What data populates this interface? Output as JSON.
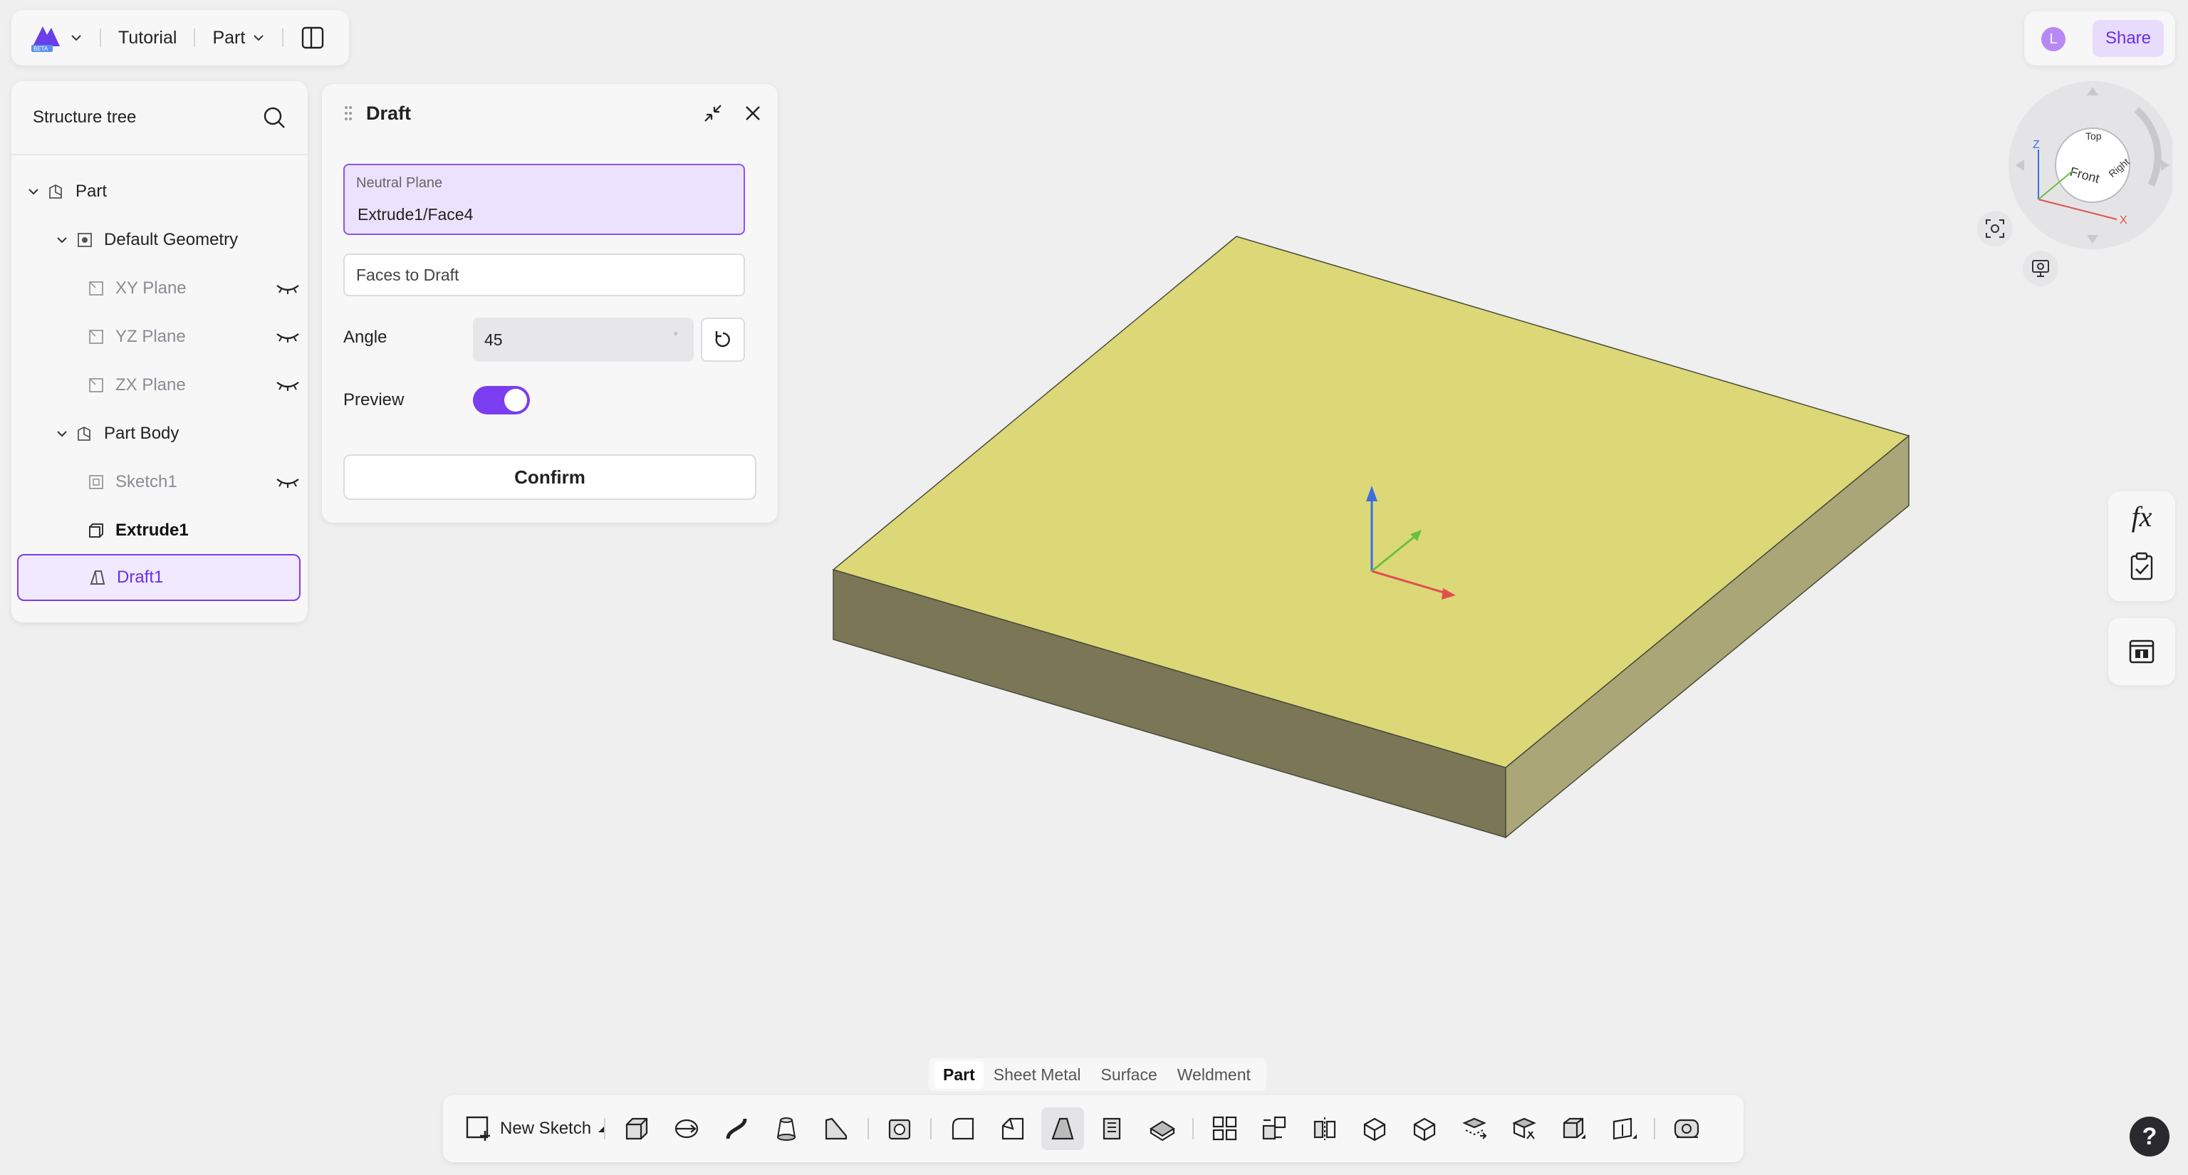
{
  "topbar": {
    "logo_icon": "onshape-beta-logo-icon",
    "doc_title": "Tutorial",
    "workspace": "Part",
    "layout_icon": "panel-layout-icon"
  },
  "tree": {
    "title": "Structure tree",
    "items": [
      {
        "label": "Part"
      },
      {
        "label": "Default Geometry"
      },
      {
        "label": "XY Plane"
      },
      {
        "label": "YZ Plane"
      },
      {
        "label": "ZX Plane"
      },
      {
        "label": "Part Body"
      },
      {
        "label": "Sketch1"
      },
      {
        "label": "Extrude1"
      },
      {
        "label": "Draft1"
      }
    ]
  },
  "draft": {
    "title": "Draft",
    "neutral_plane_label": "Neutral Plane",
    "neutral_plane_value": "Extrude1/Face4",
    "faces_placeholder": "Faces to Draft",
    "angle_label": "Angle",
    "angle_value": "45",
    "angle_unit": "°",
    "preview_label": "Preview",
    "preview_on": true,
    "confirm_label": "Confirm"
  },
  "share": {
    "avatar_letter": "L",
    "share_label": "Share"
  },
  "viewcube": {
    "top": "Top",
    "front": "Front",
    "right": "Right",
    "axis_z": "Z",
    "axis_x": "X"
  },
  "mode_tabs": [
    "Part",
    "Sheet Metal",
    "Surface",
    "Weldment"
  ],
  "active_mode": "Part",
  "toolbar": {
    "new_sketch_label": "New Sketch"
  },
  "help_label": "?",
  "right_tools": {
    "fx_label": "fx"
  },
  "colors": {
    "accent": "#7b3df0",
    "part_top": "#dcd878",
    "part_front": "#7a7656",
    "part_side": "#aba677"
  }
}
